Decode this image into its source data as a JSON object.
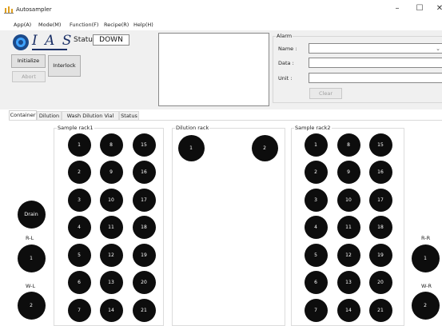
{
  "window": {
    "title": "Autosampler",
    "controls": {
      "minimize": "–",
      "maximize": "☐",
      "close": "✕"
    }
  },
  "menu": [
    "App(A)",
    "Mode(M)",
    "Function(F)",
    "Recipe(R)",
    "Help(H)"
  ],
  "logo": {
    "text": "I A S"
  },
  "status": {
    "label": "Status",
    "value": "DOWN"
  },
  "buttons": {
    "initialize": "Initialize",
    "interlock": "Interlock",
    "abort": "Abort",
    "clear": "Clear"
  },
  "alarm": {
    "title": "Alarm",
    "name_label": "Name :",
    "data_label": "Data :",
    "unit_label": "Unit :",
    "name_value": "",
    "data_value": "",
    "unit_value": ""
  },
  "tabs": [
    "Container",
    "Dilution",
    "Wash Dilution Vial",
    "Status"
  ],
  "active_tab": "Container",
  "racks": {
    "sample_rack1": {
      "title": "Sample rack1",
      "columns": [
        [
          "1",
          "2",
          "3",
          "4",
          "5",
          "6",
          "7"
        ],
        [
          "8",
          "9",
          "10",
          "11",
          "12",
          "13",
          "14"
        ],
        [
          "15",
          "16",
          "17",
          "18",
          "19",
          "20",
          "21"
        ]
      ]
    },
    "dilution_rack": {
      "title": "Dilution rack",
      "wells": [
        "1",
        "2"
      ]
    },
    "sample_rack2": {
      "title": "Sample rack2",
      "columns": [
        [
          "1",
          "2",
          "3",
          "4",
          "5",
          "6",
          "7"
        ],
        [
          "8",
          "9",
          "10",
          "11",
          "12",
          "13",
          "14"
        ],
        [
          "15",
          "16",
          "17",
          "18",
          "19",
          "20",
          "21"
        ]
      ]
    }
  },
  "left_side": {
    "drain": "Drain",
    "rl_label": "R-L",
    "rl_value": "1",
    "wl_label": "W-L",
    "wl_value": "2"
  },
  "right_side": {
    "rr_label": "R-R",
    "rr_value": "1",
    "wr_label": "W-R",
    "wr_value": "2"
  },
  "colors": {
    "well": "#0d0d0d",
    "logo_blue": "#1a2f66",
    "panel": "#f0f0f0"
  }
}
